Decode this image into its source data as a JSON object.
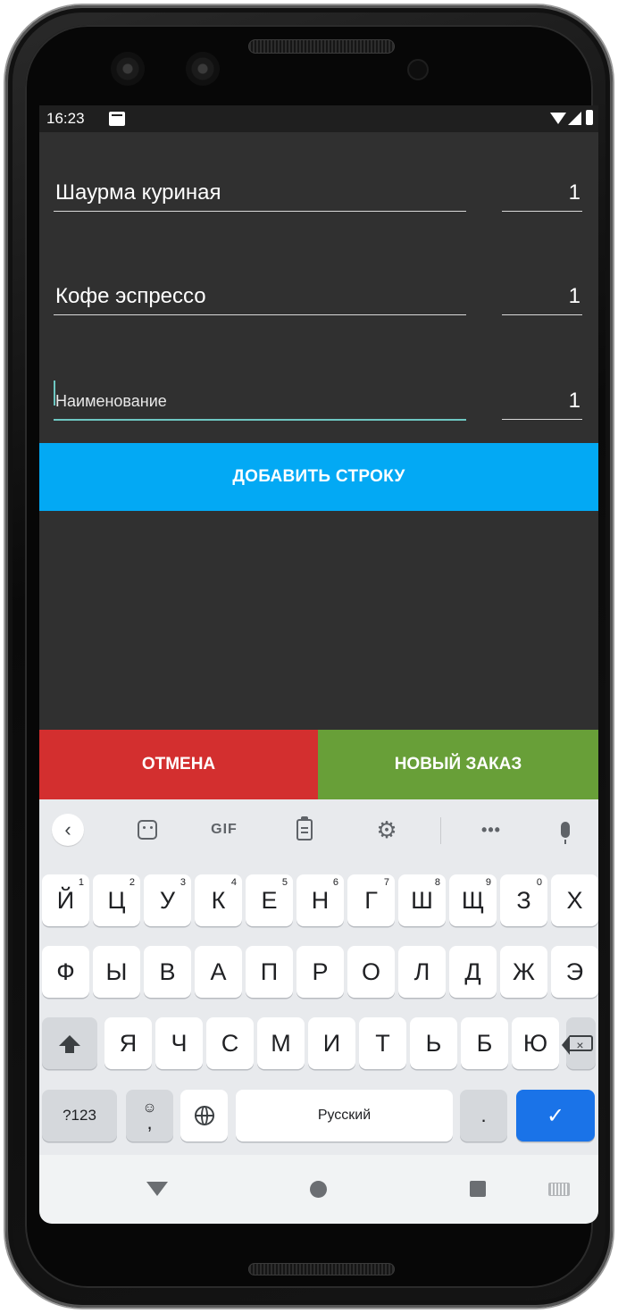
{
  "status_bar": {
    "time": "16:23"
  },
  "order_rows": [
    {
      "name_value": "Шаурма куриная",
      "qty_value": "1"
    },
    {
      "name_value": "Кофе эспрессо",
      "qty_value": "1"
    }
  ],
  "new_row": {
    "name_placeholder": "Наименование",
    "qty_value": "1"
  },
  "buttons": {
    "add_row": "ДОБАВИТЬ СТРОКУ",
    "cancel": "ОТМЕНА",
    "new_order": "НОВЫЙ ЗАКАЗ"
  },
  "colors": {
    "add_row": "#03A9F4",
    "cancel": "#D32F2F",
    "new_order": "#689F38",
    "focus_underline": "#6EC7C2"
  },
  "keyboard": {
    "toolbar": {
      "back": "‹",
      "gif": "GIF",
      "settings": "⚙",
      "more": "•••",
      "icons": [
        "chevron-left-icon",
        "sticker-icon",
        "gif-icon",
        "clipboard-icon",
        "settings-icon",
        "more-icon",
        "mic-icon"
      ]
    },
    "row1": [
      {
        "label": "Й",
        "hint": "1"
      },
      {
        "label": "Ц",
        "hint": "2"
      },
      {
        "label": "У",
        "hint": "3"
      },
      {
        "label": "К",
        "hint": "4"
      },
      {
        "label": "Е",
        "hint": "5"
      },
      {
        "label": "Н",
        "hint": "6"
      },
      {
        "label": "Г",
        "hint": "7"
      },
      {
        "label": "Ш",
        "hint": "8"
      },
      {
        "label": "Щ",
        "hint": "9"
      },
      {
        "label": "З",
        "hint": "0"
      },
      {
        "label": "Х",
        "hint": ""
      }
    ],
    "row2": [
      "Ф",
      "Ы",
      "В",
      "А",
      "П",
      "Р",
      "О",
      "Л",
      "Д",
      "Ж",
      "Э"
    ],
    "row3": [
      "Я",
      "Ч",
      "С",
      "М",
      "И",
      "Т",
      "Ь",
      "Б",
      "Ю"
    ],
    "bottom": {
      "symbols": "?123",
      "emoji_top": "☺",
      "comma": ",",
      "space": "Русский",
      "period": ".",
      "enter": "✓"
    }
  }
}
